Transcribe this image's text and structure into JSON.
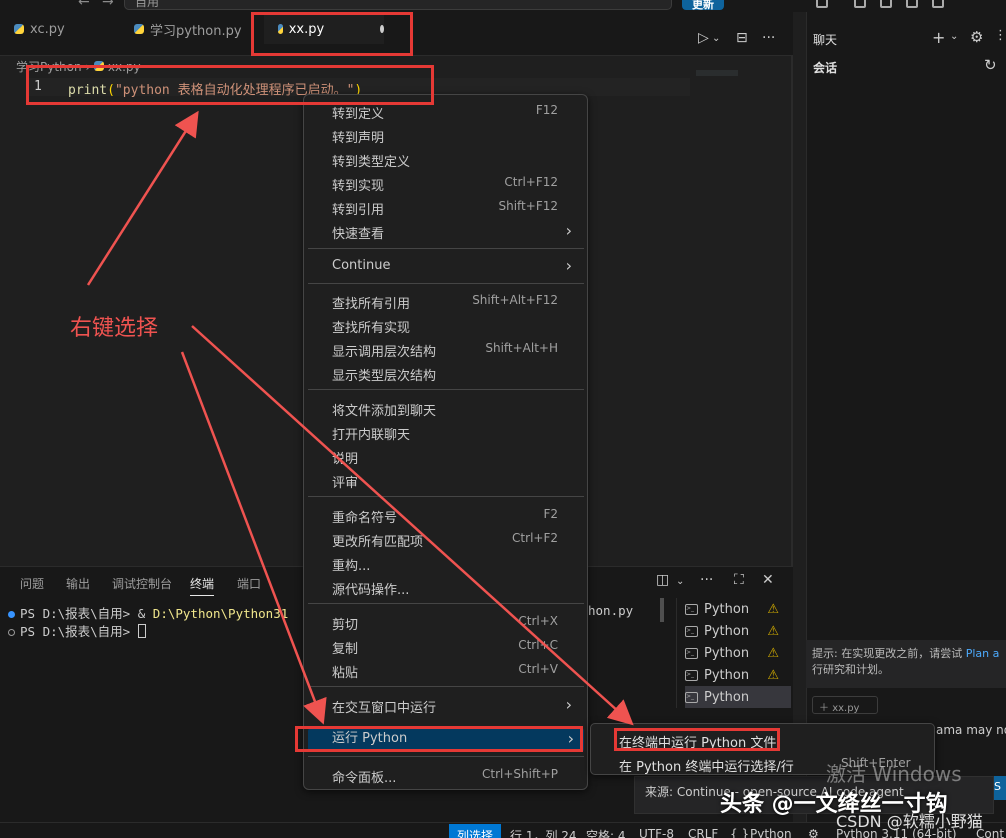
{
  "titlebar": {
    "search_text": "自用",
    "update_label": "更新"
  },
  "tabs": [
    {
      "label": "xc.py"
    },
    {
      "label": "学习python.py"
    },
    {
      "label": "xx.py"
    }
  ],
  "editor": {
    "breadcrumb_folder": "学习Python",
    "breadcrumb_file": "xx.py",
    "line_number": "1",
    "code_fn": "print",
    "code_open": "(",
    "code_str": "\"python 表格自动化处理程序已启动。\"",
    "code_close": ")"
  },
  "context_menu": {
    "items": [
      {
        "label": "转到定义",
        "shortcut": "F12"
      },
      {
        "label": "转到声明",
        "shortcut": ""
      },
      {
        "label": "转到类型定义",
        "shortcut": ""
      },
      {
        "label": "转到实现",
        "shortcut": "Ctrl+F12"
      },
      {
        "label": "转到引用",
        "shortcut": "Shift+F12"
      },
      {
        "label": "快速查看",
        "shortcut": ""
      },
      {
        "label": "Continue",
        "shortcut": ""
      },
      {
        "label": "查找所有引用",
        "shortcut": "Shift+Alt+F12"
      },
      {
        "label": "查找所有实现",
        "shortcut": ""
      },
      {
        "label": "显示调用层次结构",
        "shortcut": "Shift+Alt+H"
      },
      {
        "label": "显示类型层次结构",
        "shortcut": ""
      },
      {
        "label": "将文件添加到聊天",
        "shortcut": ""
      },
      {
        "label": "打开内联聊天",
        "shortcut": ""
      },
      {
        "label": "说明",
        "shortcut": ""
      },
      {
        "label": "评审",
        "shortcut": ""
      },
      {
        "label": "重命名符号",
        "shortcut": "F2"
      },
      {
        "label": "更改所有匹配项",
        "shortcut": "Ctrl+F2"
      },
      {
        "label": "重构...",
        "shortcut": ""
      },
      {
        "label": "源代码操作...",
        "shortcut": ""
      },
      {
        "label": "剪切",
        "shortcut": "Ctrl+X"
      },
      {
        "label": "复制",
        "shortcut": "Ctrl+C"
      },
      {
        "label": "粘贴",
        "shortcut": "Ctrl+V"
      },
      {
        "label": "在交互窗口中运行",
        "shortcut": ""
      },
      {
        "label": "运行 Python",
        "shortcut": ""
      },
      {
        "label": "命令面板...",
        "shortcut": "Ctrl+Shift+P"
      }
    ]
  },
  "submenu": {
    "run_in_terminal": "在终端中运行 Python 文件",
    "run_selection": "在 Python 终端中运行选择/行",
    "run_selection_key": "Shift+Enter"
  },
  "panel": {
    "tabs": [
      "问题",
      "输出",
      "调试控制台",
      "终端",
      "端口"
    ],
    "terminal_line1_prompt": "PS D:\\报表\\自用> & ",
    "terminal_line1_path": "D:\\Python\\Python31",
    "terminal_line1_tail": "hon.py",
    "terminal_line2_prompt": "PS D:\\报表\\自用> ",
    "terminal_list": [
      "Python",
      "Python",
      "Python",
      "Python",
      "Python"
    ]
  },
  "chat": {
    "title": "聊天",
    "session": "会话",
    "tip_prefix": "提示: 在实现更改之前，请尝试 ",
    "tip_link": "Plan a",
    "tip_suffix": "行研究和计划。",
    "file_chip": "xx.py",
    "disclaimer": "ama may no",
    "send_label": "S"
  },
  "notification": {
    "text": "来源: Continue - open-source AI code agent"
  },
  "statusbar": {
    "col_select": "列选择",
    "position": "行 1，列 24",
    "spaces": "空格: 4",
    "encoding": "UTF-8",
    "eol": "CRLF",
    "language": "Python",
    "interpreter": "Python 3.11 (64-bit)",
    "extra": "Cont"
  },
  "annotations": {
    "note": "右键选择",
    "activate": "激活 Windows",
    "watermark1": "头条 @一文绛丝一寸钩",
    "watermark2": "CSDN @软糯小野猫"
  },
  "colors": {
    "highlight": "#e53935",
    "accent": "#0078d4",
    "menu_selected": "#04395e"
  }
}
